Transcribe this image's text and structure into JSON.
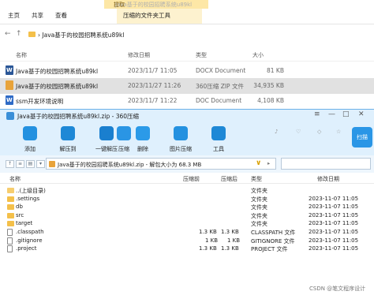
{
  "explorer": {
    "context_tab": "提取",
    "window_title": "Java基于的校园招聘系统u89kl",
    "tabs": [
      "主页",
      "共享",
      "查看",
      "压缩的文件夹工具"
    ],
    "nav_back": "←",
    "nav_up": "↑",
    "breadcrumb": "› Java基于的校园招聘系统u89kl",
    "columns": {
      "name": "名称",
      "date": "修改日期",
      "type": "类型",
      "size": "大小"
    },
    "files": [
      {
        "name": "Java基于的校园招聘系统u89kl",
        "date": "2023/11/7 11:05",
        "type": "DOCX Document",
        "size": "81 KB",
        "icon": "docx-icon",
        "selected": false
      },
      {
        "name": "Java基于的校园招聘系统u89kl",
        "date": "2023/11/27 11:26",
        "type": "360压缩 ZIP 文件",
        "size": "34,935 KB",
        "icon": "zip-icon",
        "selected": true
      },
      {
        "name": "ssm开发环境说明",
        "date": "2023/11/7 11:22",
        "type": "DOC Document",
        "size": "4,108 KB",
        "icon": "doc-icon",
        "selected": false
      }
    ]
  },
  "zip": {
    "title": "Java基于的校园招聘系统u89kl.zip - 360压缩",
    "window_controls": [
      "≡",
      "—",
      "□",
      "✕"
    ],
    "toolbar": [
      {
        "label": "添加",
        "icon": "add-icon"
      },
      {
        "label": "解压到",
        "icon": "extract-to-icon"
      },
      {
        "label": "一键解压",
        "icon": "one-click-extract-icon"
      },
      {
        "label": "压缩",
        "icon": "compress-icon"
      },
      {
        "label": "删除",
        "icon": "delete-icon"
      },
      {
        "label": "图片压缩",
        "icon": "image-compress-icon"
      },
      {
        "label": "工具",
        "icon": "tools-icon"
      }
    ],
    "scan_label": "扫描",
    "path_text": "Java基于的校园招聘系统u89kl.zip - 解包大小为 68.3 MB",
    "columns": {
      "name": "名称",
      "compressed": "压缩前",
      "size": "压缩后",
      "type": "类型",
      "modified": "修改日期"
    },
    "entries": [
      {
        "name": "..(上级目录)",
        "compressed": "",
        "size": "",
        "type": "文件夹",
        "modified": "",
        "kind": "up"
      },
      {
        "name": ".settings",
        "compressed": "",
        "size": "",
        "type": "文件夹",
        "modified": "2023-11-07 11:05",
        "kind": "folder"
      },
      {
        "name": "db",
        "compressed": "",
        "size": "",
        "type": "文件夹",
        "modified": "2023-11-07 11:05",
        "kind": "folder"
      },
      {
        "name": "src",
        "compressed": "",
        "size": "",
        "type": "文件夹",
        "modified": "2023-11-07 11:05",
        "kind": "folder"
      },
      {
        "name": "target",
        "compressed": "",
        "size": "",
        "type": "文件夹",
        "modified": "2023-11-07 11:05",
        "kind": "folder"
      },
      {
        "name": ".classpath",
        "compressed": "1.3 KB",
        "size": "1.3 KB",
        "type": "CLASSPATH 文件",
        "modified": "2023-11-07 11:05",
        "kind": "file"
      },
      {
        "name": ".gitignore",
        "compressed": "1 KB",
        "size": "1 KB",
        "type": "GITIGNORE 文件",
        "modified": "2023-11-07 11:05",
        "kind": "file"
      },
      {
        "name": ".project",
        "compressed": "1.3 KB",
        "size": "1.3 KB",
        "type": "PROJECT 文件",
        "modified": "2023-11-07 11:05",
        "kind": "file"
      }
    ]
  },
  "watermark": "CSDN @笔文程序设计"
}
